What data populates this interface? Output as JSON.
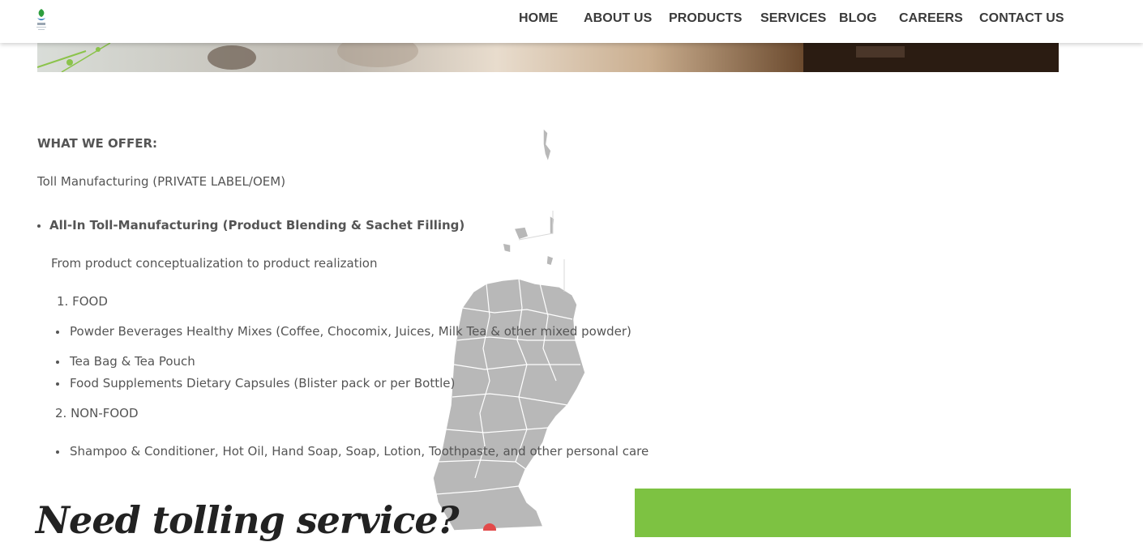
{
  "nav": {
    "items": [
      {
        "label": "HOME"
      },
      {
        "label": "ABOUT US"
      },
      {
        "label": "PRODUCTS"
      },
      {
        "label": "SERVICES"
      },
      {
        "label": "BLOG"
      },
      {
        "label": "CAREERS"
      },
      {
        "label": "CONTACT US"
      }
    ]
  },
  "logo": {
    "icon": "leaf-logo",
    "color": "#2e9e3e"
  },
  "offer": {
    "heading": "WHAT WE OFFER:",
    "subtitle": "Toll Manufacturing (PRIVATE LABEL/OEM)",
    "main_bullet": "All-In Toll-Manufacturing (Product Blending & Sachet Filling)",
    "tagline": "From product conceptualization to product realization",
    "food": {
      "label": "1. FOOD",
      "items": [
        "Powder Beverages Healthy Mixes (Coffee, Chocomix, Juices, Milk Tea & other mixed powder)",
        "Tea Bag & Tea Pouch",
        "Food Supplements Dietary Capsules (Blister pack or per Bottle)"
      ]
    },
    "nonfood": {
      "label": "2. NON-FOOD",
      "items": [
        "Shampoo & Conditioner, Hot Oil, Hand Soap, Soap, Lotion, Toothpaste, and other personal care"
      ]
    }
  },
  "cta": {
    "heading": "Need tolling service?"
  },
  "colors": {
    "accent_green": "#7dc242",
    "text": "#555555",
    "map_gray": "#b5b5b5"
  }
}
